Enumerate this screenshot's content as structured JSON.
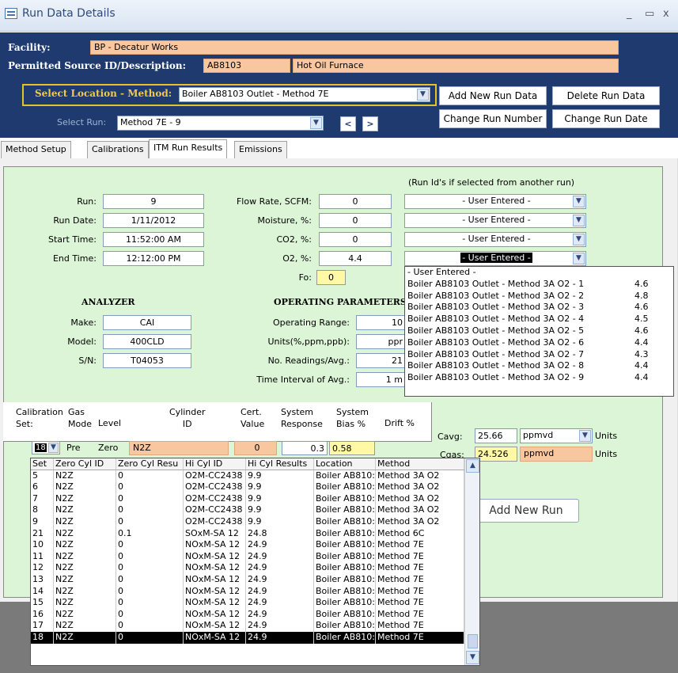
{
  "window": {
    "title": "Run Data Details",
    "controls": [
      "_",
      "▭",
      "x"
    ]
  },
  "header": {
    "facility_label": "Facility:",
    "facility_value": "BP - Decatur Works",
    "source_label": "Permitted Source ID/Description:",
    "source_id": "AB8103",
    "source_desc": "Hot Oil Furnace",
    "select_location_label": "Select Location - Method:",
    "select_location_value": "Boiler AB8103 Outlet - Method 7E",
    "select_run_label": "Select Run:",
    "select_run_value": "Method 7E - 9",
    "prev_btn": "<",
    "next_btn": ">",
    "add_run_data": "Add New Run Data",
    "delete_run_data": "Delete Run Data",
    "change_run_number": "Change Run Number",
    "change_run_date": "Change Run Date"
  },
  "tabs": [
    "Method Setup",
    "Calibrations",
    "ITM Run Results",
    "Emissions"
  ],
  "active_tab": "ITM Run Results",
  "run": {
    "run_label": "Run:",
    "run_value": "9",
    "date_label": "Run Date:",
    "date_value": "1/11/2012",
    "start_label": "Start Time:",
    "start_value": "11:52:00 AM",
    "end_label": "End Time:",
    "end_value": "12:12:00 PM"
  },
  "flow": {
    "flow_label": "Flow Rate, SCFM:",
    "flow_value": "0",
    "moisture_label": "Moisture, %:",
    "moisture_value": "0",
    "co2_label": "CO2, %:",
    "co2_value": "0",
    "o2_label": "O2, %:",
    "o2_value": "4.4",
    "fo_label": "Fo:",
    "fo_value": "0"
  },
  "run_ids": {
    "header": "(Run Id's if selected from another run)",
    "values": [
      "- User Entered -",
      "- User Entered -",
      "- User Entered -",
      "- User Entered -"
    ]
  },
  "o2_dropdown": [
    {
      "label": "- User Entered -",
      "val": ""
    },
    {
      "label": "Boiler AB8103 Outlet - Method 3A O2 - 1",
      "val": "4.6"
    },
    {
      "label": "Boiler AB8103 Outlet - Method 3A O2 - 2",
      "val": "4.8"
    },
    {
      "label": "Boiler AB8103 Outlet - Method 3A O2 - 3",
      "val": "4.6"
    },
    {
      "label": "Boiler AB8103 Outlet - Method 3A O2 - 4",
      "val": "4.5"
    },
    {
      "label": "Boiler AB8103 Outlet - Method 3A O2 - 5",
      "val": "4.6"
    },
    {
      "label": "Boiler AB8103 Outlet - Method 3A O2 - 6",
      "val": "4.4"
    },
    {
      "label": "Boiler AB8103 Outlet - Method 3A O2 - 7",
      "val": "4.3"
    },
    {
      "label": "Boiler AB8103 Outlet - Method 3A O2 - 8",
      "val": "4.4"
    },
    {
      "label": "Boiler AB8103 Outlet - Method 3A O2 - 9",
      "val": "4.4"
    }
  ],
  "analyzer": {
    "title": "ANALYZER",
    "make_label": "Make:",
    "make_value": "CAI",
    "model_label": "Model:",
    "model_value": "400CLD",
    "sn_label": "S/N:",
    "sn_value": "T04053"
  },
  "operating": {
    "title": "OPERATING PARAMETERS",
    "range_label": "Operating Range:",
    "range_value": "10",
    "units_label": "Units(%,ppm,ppb):",
    "units_value": "ppr",
    "readings_label": "No. Readings/Avg.:",
    "readings_value": "21",
    "interval_label": "Time Interval of Avg.:",
    "interval_value": "1 m"
  },
  "calibration": {
    "headers": [
      "Calibration\nSet:",
      "Gas\nMode",
      "Level",
      "Cylinder\nID",
      "Cert.\nValue",
      "System\nResponse",
      "System\nBias %",
      "Drift %"
    ],
    "row": {
      "set": "18",
      "mode": "Pre",
      "level": "Zero",
      "cyl": "N2Z",
      "cert": "0",
      "resp": "0.3",
      "bias": "0.58"
    }
  },
  "cal_dropdown": {
    "headers": [
      "Set",
      "Zero Cyl ID",
      "Zero Cyl Resu",
      "Hi Cyl ID",
      "Hi Cyl Results",
      "Location",
      "Method"
    ],
    "rows": [
      [
        "5",
        "N2Z",
        "0",
        "O2M-CC2438",
        "9.9",
        "Boiler AB810:",
        "Method 3A O2"
      ],
      [
        "6",
        "N2Z",
        "0",
        "O2M-CC2438",
        "9.9",
        "Boiler AB810:",
        "Method 3A O2"
      ],
      [
        "7",
        "N2Z",
        "0",
        "O2M-CC2438",
        "9.9",
        "Boiler AB810:",
        "Method 3A O2"
      ],
      [
        "8",
        "N2Z",
        "0",
        "O2M-CC2438",
        "9.9",
        "Boiler AB810:",
        "Method 3A O2"
      ],
      [
        "9",
        "N2Z",
        "0",
        "O2M-CC2438",
        "9.9",
        "Boiler AB810:",
        "Method 3A O2"
      ],
      [
        "21",
        "N2Z",
        "0.1",
        "SOxM-SA 12",
        "24.8",
        "Boiler AB810:",
        "Method 6C"
      ],
      [
        "10",
        "N2Z",
        "0",
        "NOxM-SA 12",
        "24.9",
        "Boiler AB810:",
        "Method 7E"
      ],
      [
        "11",
        "N2Z",
        "0",
        "NOxM-SA 12",
        "24.9",
        "Boiler AB810:",
        "Method 7E"
      ],
      [
        "12",
        "N2Z",
        "0",
        "NOxM-SA 12",
        "24.9",
        "Boiler AB810:",
        "Method 7E"
      ],
      [
        "13",
        "N2Z",
        "0",
        "NOxM-SA 12",
        "24.9",
        "Boiler AB810:",
        "Method 7E"
      ],
      [
        "14",
        "N2Z",
        "0",
        "NOxM-SA 12",
        "24.9",
        "Boiler AB810:",
        "Method 7E"
      ],
      [
        "15",
        "N2Z",
        "0",
        "NOxM-SA 12",
        "24.9",
        "Boiler AB810:",
        "Method 7E"
      ],
      [
        "16",
        "N2Z",
        "0",
        "NOxM-SA 12",
        "24.9",
        "Boiler AB810:",
        "Method 7E"
      ],
      [
        "17",
        "N2Z",
        "0",
        "NOxM-SA 12",
        "24.9",
        "Boiler AB810:",
        "Method 7E"
      ],
      [
        "18",
        "N2Z",
        "0",
        "NOxM-SA 12",
        "24.9",
        "Boiler AB810:",
        "Method 7E"
      ]
    ],
    "selected_index": 14
  },
  "results": {
    "cavg_label": "Cavg:",
    "cavg_value": "25.66",
    "cavg_units": "ppmvd",
    "cavg_units_label": "Units",
    "cgas_label": "Cgas:",
    "cgas_value": "24.526",
    "cgas_units": "ppmvd",
    "cgas_units_label": "Units"
  },
  "add_new_run": "Add New Run"
}
